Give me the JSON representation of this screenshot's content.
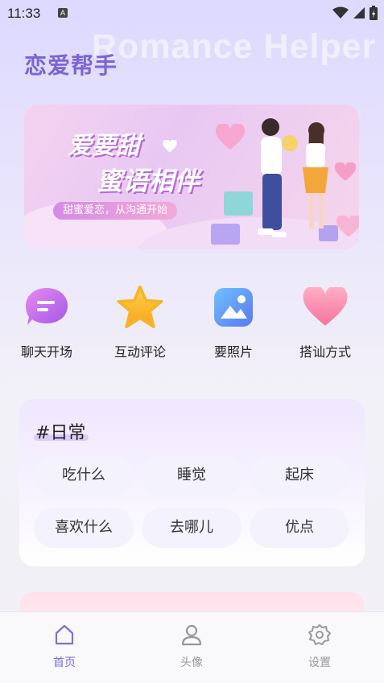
{
  "status_bar": {
    "time": "11:33",
    "notification_icon": "A"
  },
  "header": {
    "title": "恋爱帮手",
    "watermark": "Romance Helper"
  },
  "banner": {
    "headline_1": "爱要甜",
    "headline_2": "蜜语相伴",
    "subtitle": "甜蜜爱恋，从沟通开始"
  },
  "quick_actions": [
    {
      "label": "聊天开场",
      "icon": "chat-bubble-icon"
    },
    {
      "label": "互动评论",
      "icon": "star-icon"
    },
    {
      "label": "要照片",
      "icon": "image-icon"
    },
    {
      "label": "搭讪方式",
      "icon": "heart-icon"
    }
  ],
  "category": {
    "tag": "#日常",
    "chips": [
      "吃什么",
      "睡觉",
      "起床",
      "喜欢什么",
      "去哪儿",
      "优点"
    ]
  },
  "bottom_nav": {
    "items": [
      {
        "label": "首页",
        "icon": "home-icon",
        "active": true
      },
      {
        "label": "头像",
        "icon": "person-icon",
        "active": false
      },
      {
        "label": "设置",
        "icon": "gear-icon",
        "active": false
      }
    ]
  },
  "colors": {
    "accent": "#7d63d7",
    "nav_active": "#7b6fe0",
    "nav_inactive": "#999999"
  }
}
